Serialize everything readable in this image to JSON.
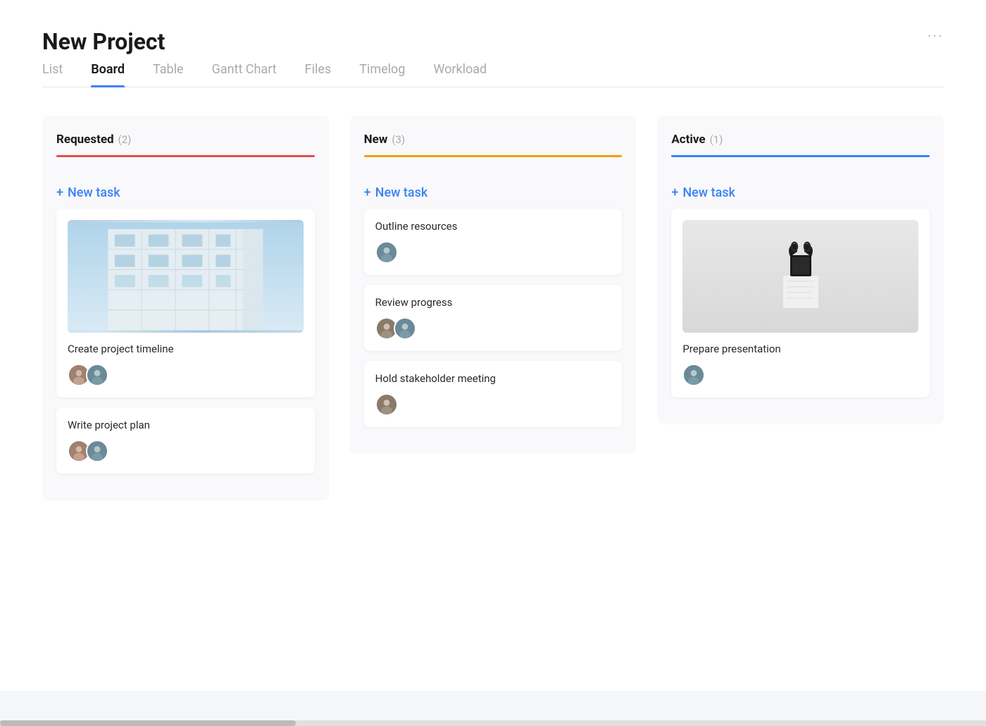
{
  "page": {
    "title": "New Project",
    "more_options": "···"
  },
  "tabs": [
    {
      "id": "list",
      "label": "List",
      "active": false
    },
    {
      "id": "board",
      "label": "Board",
      "active": true
    },
    {
      "id": "table",
      "label": "Table",
      "active": false
    },
    {
      "id": "gantt",
      "label": "Gantt Chart",
      "active": false
    },
    {
      "id": "files",
      "label": "Files",
      "active": false
    },
    {
      "id": "timelog",
      "label": "Timelog",
      "active": false
    },
    {
      "id": "workload",
      "label": "Workload",
      "active": false
    }
  ],
  "columns": [
    {
      "id": "requested",
      "title": "Requested",
      "count": "(2)",
      "divider_class": "divider-red",
      "new_task_label": "+ New task",
      "cards": [
        {
          "id": "card-1",
          "has_image": true,
          "image_type": "building",
          "title": "Create project timeline",
          "avatars": [
            "av1",
            "av2"
          ]
        },
        {
          "id": "card-2",
          "has_image": false,
          "title": "Write project plan",
          "avatars": [
            "av1",
            "av2"
          ]
        }
      ]
    },
    {
      "id": "new",
      "title": "New",
      "count": "(3)",
      "divider_class": "divider-orange",
      "new_task_label": "+ New task",
      "cards": [
        {
          "id": "card-3",
          "has_image": false,
          "title": "Outline resources",
          "avatars": [
            "av2"
          ]
        },
        {
          "id": "card-4",
          "has_image": false,
          "title": "Review progress",
          "avatars": [
            "av3",
            "av2"
          ]
        },
        {
          "id": "card-5",
          "has_image": false,
          "title": "Hold stakeholder meeting",
          "avatars": [
            "av3"
          ]
        }
      ]
    },
    {
      "id": "active",
      "title": "Active",
      "count": "(1)",
      "divider_class": "divider-blue",
      "new_task_label": "+ New task",
      "cards": [
        {
          "id": "card-6",
          "has_image": true,
          "image_type": "clip",
          "title": "Prepare presentation",
          "avatars": [
            "av2"
          ]
        }
      ]
    }
  ]
}
